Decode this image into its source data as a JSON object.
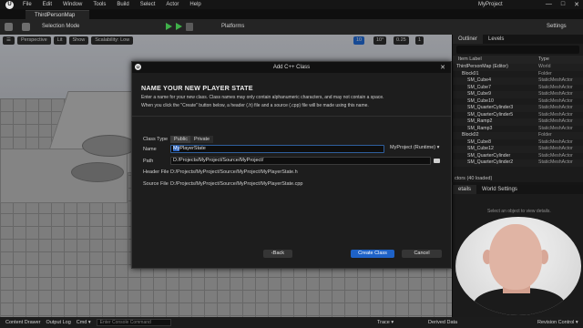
{
  "app": {
    "menu": [
      "File",
      "Edit",
      "Window",
      "Tools",
      "Build",
      "Select",
      "Actor",
      "Help"
    ],
    "project_name": "MyProject",
    "map_tab": "ThirdPersonMap",
    "window_controls": [
      "—",
      "□",
      "✕"
    ]
  },
  "toolbar": {
    "selection_mode": "Selection Mode",
    "platforms": "Platforms",
    "settings": "Settings"
  },
  "viewport": {
    "perspective": "Perspective",
    "lit": "Lit",
    "show": "Show",
    "scalability": "Scalability: Low",
    "grid_snap": "10",
    "rotation_snap": "10°",
    "scale_snap": "0.25",
    "camera_speed": "1"
  },
  "outliner": {
    "tabs": [
      "Outliner",
      "Levels"
    ],
    "columns": [
      "Item Label",
      "Type"
    ],
    "rows": [
      {
        "label": "ThirdPersonMap (Editor)",
        "type": "World",
        "indent": 0
      },
      {
        "label": "Block01",
        "type": "Folder",
        "indent": 1
      },
      {
        "label": "SM_Cube4",
        "type": "StaticMeshActor",
        "indent": 2
      },
      {
        "label": "SM_Cube7",
        "type": "StaticMeshActor",
        "indent": 2
      },
      {
        "label": "SM_Cube9",
        "type": "StaticMeshActor",
        "indent": 2
      },
      {
        "label": "SM_Cube10",
        "type": "StaticMeshActor",
        "indent": 2
      },
      {
        "label": "SM_QuarterCylinder3",
        "type": "StaticMeshActor",
        "indent": 2
      },
      {
        "label": "SM_QuarterCylinder5",
        "type": "StaticMeshActor",
        "indent": 2
      },
      {
        "label": "SM_Ramp2",
        "type": "StaticMeshActor",
        "indent": 2
      },
      {
        "label": "SM_Ramp3",
        "type": "StaticMeshActor",
        "indent": 2
      },
      {
        "label": "Block02",
        "type": "Folder",
        "indent": 1
      },
      {
        "label": "SM_Cube8",
        "type": "StaticMeshActor",
        "indent": 2
      },
      {
        "label": "SM_Cube12",
        "type": "StaticMeshActor",
        "indent": 2
      },
      {
        "label": "SM_QuarterCylinder",
        "type": "StaticMeshActor",
        "indent": 2
      },
      {
        "label": "SM_QuarterCylinder2",
        "type": "StaticMeshActor",
        "indent": 2
      }
    ],
    "actor_count": "ctors (40 loaded)"
  },
  "details": {
    "tabs": [
      "etails",
      "World Settings"
    ],
    "hint": "Select an object to view details."
  },
  "dialog": {
    "window_title": "Add C++ Class",
    "heading": "NAME YOUR NEW PLAYER STATE",
    "desc_line1": "Enter a name for your new class. Class names may only contain alphanumeric characters, and may not contain a space.",
    "desc_line2": "When you click the \"Create\" button below, a header (.h) file and a source (.cpp) file will be made using this name.",
    "class_type_label": "Class Type",
    "class_type_options": [
      "Public",
      "Private"
    ],
    "name_label": "Name",
    "name_value_selected": "My",
    "name_value_rest": "PlayerState",
    "module": "MyProject (Runtime) ▾",
    "path_label": "Path",
    "path_value": "D:/Projects/MyProject/Source/MyProject/",
    "header_label": "Header File",
    "header_value": "D:/Projects/MyProject/Source/MyProject/MyPlayerState.h",
    "source_label": "Source File",
    "source_value": "D:/Projects/MyProject/Source/MyProject/MyPlayerState.cpp",
    "back": "Back",
    "create": "Create Class",
    "cancel": "Cancel"
  },
  "statusbar": {
    "content_drawer": "Content Drawer",
    "output_log": "Output Log",
    "cmd": "Cmd ▾",
    "console_placeholder": "Enter Console Command",
    "trace": "Trace ▾",
    "derived_data": "Derived Data",
    "revision_control": "Revision Control ▾"
  }
}
